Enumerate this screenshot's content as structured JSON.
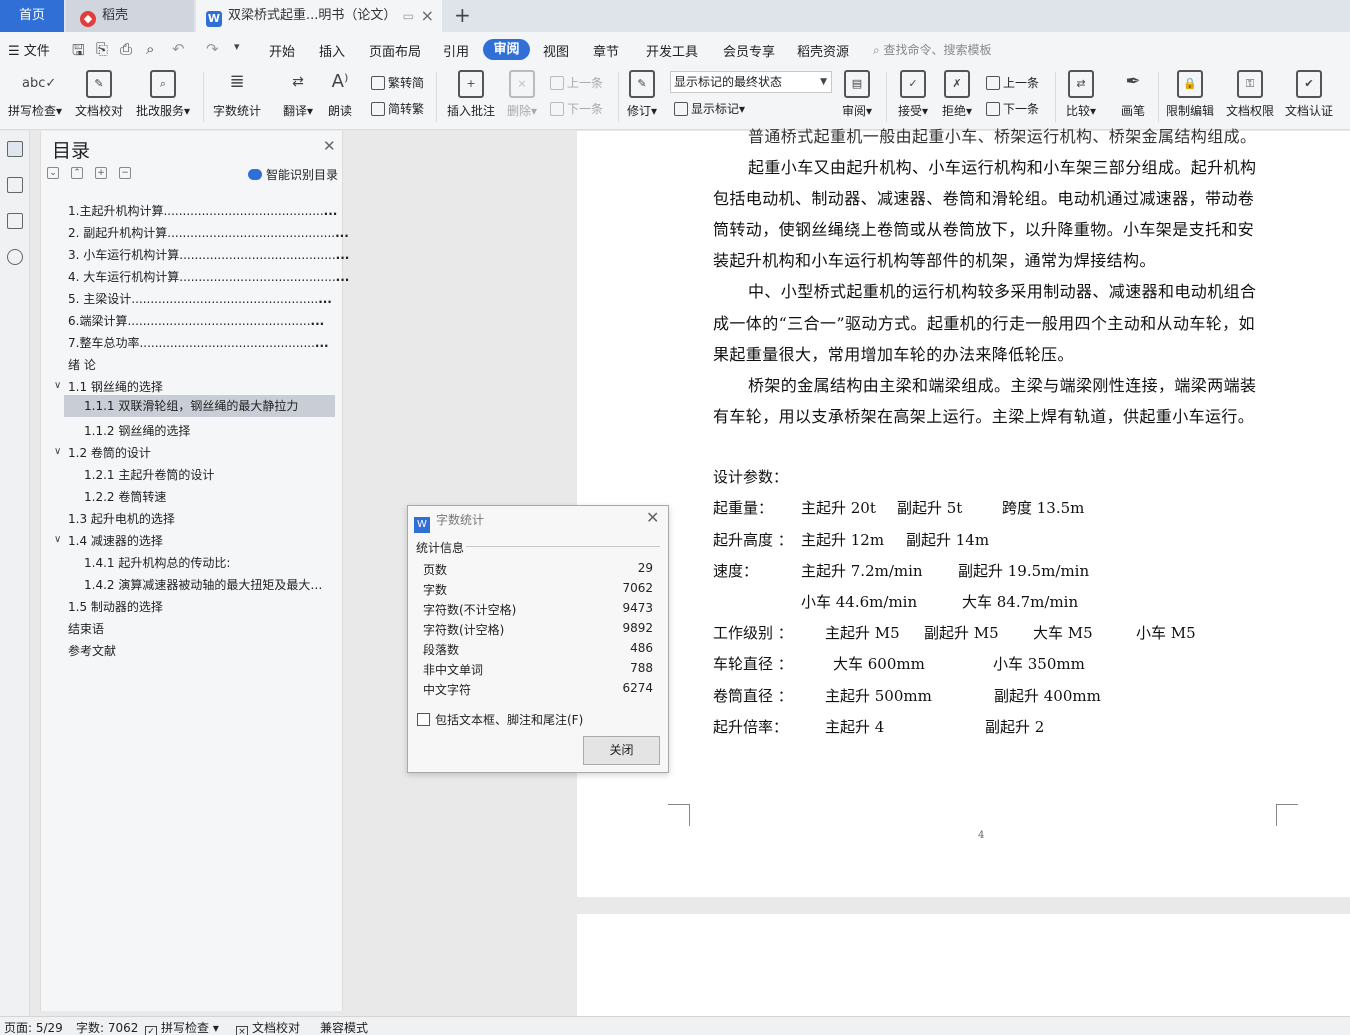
{
  "tabs": {
    "home": "首页",
    "daoke": "稻壳",
    "doc": "双梁桥式起重...明书（论文）",
    "add": "+"
  },
  "menu": {
    "file": "文件",
    "items": [
      "开始",
      "插入",
      "页面布局",
      "引用",
      "审阅",
      "视图",
      "章节",
      "开发工具",
      "会员专享",
      "稻壳资源"
    ],
    "active": "审阅",
    "search": "查找命令、搜索模板"
  },
  "ribbon": {
    "spellcheck": "拼写检查",
    "doc_proof": "文档校对",
    "correction": "批改服务",
    "word_count": "字数统计",
    "translate": "翻译",
    "read_aloud": "朗读",
    "trad_conv": "繁转简",
    "simp_conv": "简转繁",
    "insert_comment": "插入批注",
    "delete": "删除",
    "prev_item": "上一条",
    "next_item": "下一条",
    "track_changes": "修订",
    "markup_select": "显示标记的最终状态",
    "show_markup": "显示标记",
    "review": "审阅",
    "accept": "接受",
    "reject": "拒绝",
    "prev": "上一条",
    "next": "下一条",
    "compare": "比较",
    "ink": "画笔",
    "restrict_edit": "限制编辑",
    "doc_permission": "文档权限",
    "doc_cert": "文档认证"
  },
  "toc": {
    "title": "目录",
    "smart": "智能识别目录",
    "items": [
      "1.主起升机构计算",
      "2. 副起升机构计算",
      "3. 小车运行机构计算",
      "4. 大车运行机构计算",
      "5. 主梁设计",
      "6.端梁计算",
      "7.整车总功率",
      "绪  论",
      "1.1 钢丝绳的选择",
      "1.1.1 双联滑轮组，钢丝绳的最大静拉力",
      "1.1.2 钢丝绳的选择",
      "1.2 卷筒的设计",
      "1.2.1 主起升卷筒的设计",
      "1.2.2 卷筒转速",
      "1.3 起升电机的选择",
      "1.4 减速器的选择",
      "1.4.1 起升机构总的传动比:",
      "1.4.2 演算减速器被动轴的最大扭矩及最大…",
      "1.5 制动器的选择",
      "结束语",
      "参考文献"
    ]
  },
  "doc": {
    "lines": [
      "普通桥式起重机一般由起重小车、桥架运行机构、桥架金属结构组成。",
      "起重小车又由起升机构、小车运行机构和小车架三部分组成。起升机构",
      "包括电动机、制动器、减速器、卷筒和滑轮组。电动机通过减速器，带动卷",
      "筒转动，使钢丝绳绕上卷筒或从卷筒放下，以升降重物。小车架是支托和安",
      "装起升机构和小车运行机构等部件的机架，通常为焊接结构。",
      "中、小型桥式起重机的运行机构较多采用制动器、减速器和电动机组合",
      "成一体的“三合一”驱动方式。起重机的行走一般用四个主动和从动车轮，如",
      "果起重量很大，常用增加车轮的办法来降低轮压。",
      "桥架的金属结构由主梁和端梁组成。主梁与端梁刚性连接，端梁两端装",
      "有车轮，用以支承桥架在高架上运行。主梁上焊有轨道，供起重小车运行。"
    ],
    "params_title": "设计参数：",
    "params": [
      [
        "起重量：",
        "主起升 20t",
        "副起升 5t",
        "跨度 13.5m"
      ],
      [
        "起升高度 ：",
        "主起升 12m",
        "副起升 14m"
      ],
      [
        "速度：",
        "主起升  7.2m/min",
        "副起升    19.5m/min"
      ],
      [
        "",
        "小车 44.6m/min",
        "大车 84.7m/min"
      ],
      [
        "工作级别 ：",
        "主起升 M5",
        "副起升    M5",
        "大车    M5",
        "小车 M5"
      ],
      [
        "车轮直径 ：",
        "大车    600mm",
        "小车 350mm"
      ],
      [
        "卷筒直径 ：",
        "主起升    500mm",
        "副起升 400mm"
      ],
      [
        "起升倍率：",
        "主起升    4",
        "副起升    2"
      ]
    ],
    "page_number": "4"
  },
  "dialog": {
    "title": "字数统计",
    "group": "统计信息",
    "rows": [
      {
        "label": "页数",
        "value": "29"
      },
      {
        "label": "字数",
        "value": "7062"
      },
      {
        "label": "字符数(不计空格)",
        "value": "9473"
      },
      {
        "label": "字符数(计空格)",
        "value": "9892"
      },
      {
        "label": "段落数",
        "value": "486"
      },
      {
        "label": "非中文单词",
        "value": "788"
      },
      {
        "label": "中文字符",
        "value": "6274"
      }
    ],
    "checkbox": "包括文本框、脚注和尾注(F)",
    "close": "关闭"
  },
  "status": {
    "page": "页面: 5/29",
    "words": "字数: 7062",
    "spellcheck": "拼写检查",
    "proof": "文档校对",
    "compat": "兼容模式"
  }
}
